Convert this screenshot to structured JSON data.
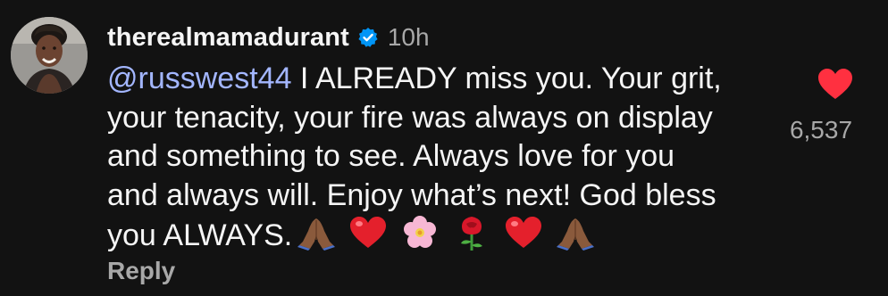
{
  "comment": {
    "username": "therealmamadurant",
    "time": "10h",
    "mention": "@russwest44",
    "lines": [
      " I ALREADY miss you. Your grit,",
      "your tenacity, your fire was always on display",
      "and something to see. Always love for you",
      "and always will. Enjoy what’s next! God bless",
      "you ALWAYS."
    ],
    "emojis": [
      "folded-hands-emoji",
      "red-heart-emoji",
      "cherry-blossom-emoji",
      "rose-emoji",
      "red-heart-emoji",
      "folded-hands-emoji"
    ],
    "reply_label": "Reply",
    "like_count": "6,537"
  },
  "colors": {
    "background": "#121212",
    "mention": "#a3b6ff",
    "verified": "#0095f6",
    "like": "#ff3040",
    "muted": "#a8a8a8"
  }
}
